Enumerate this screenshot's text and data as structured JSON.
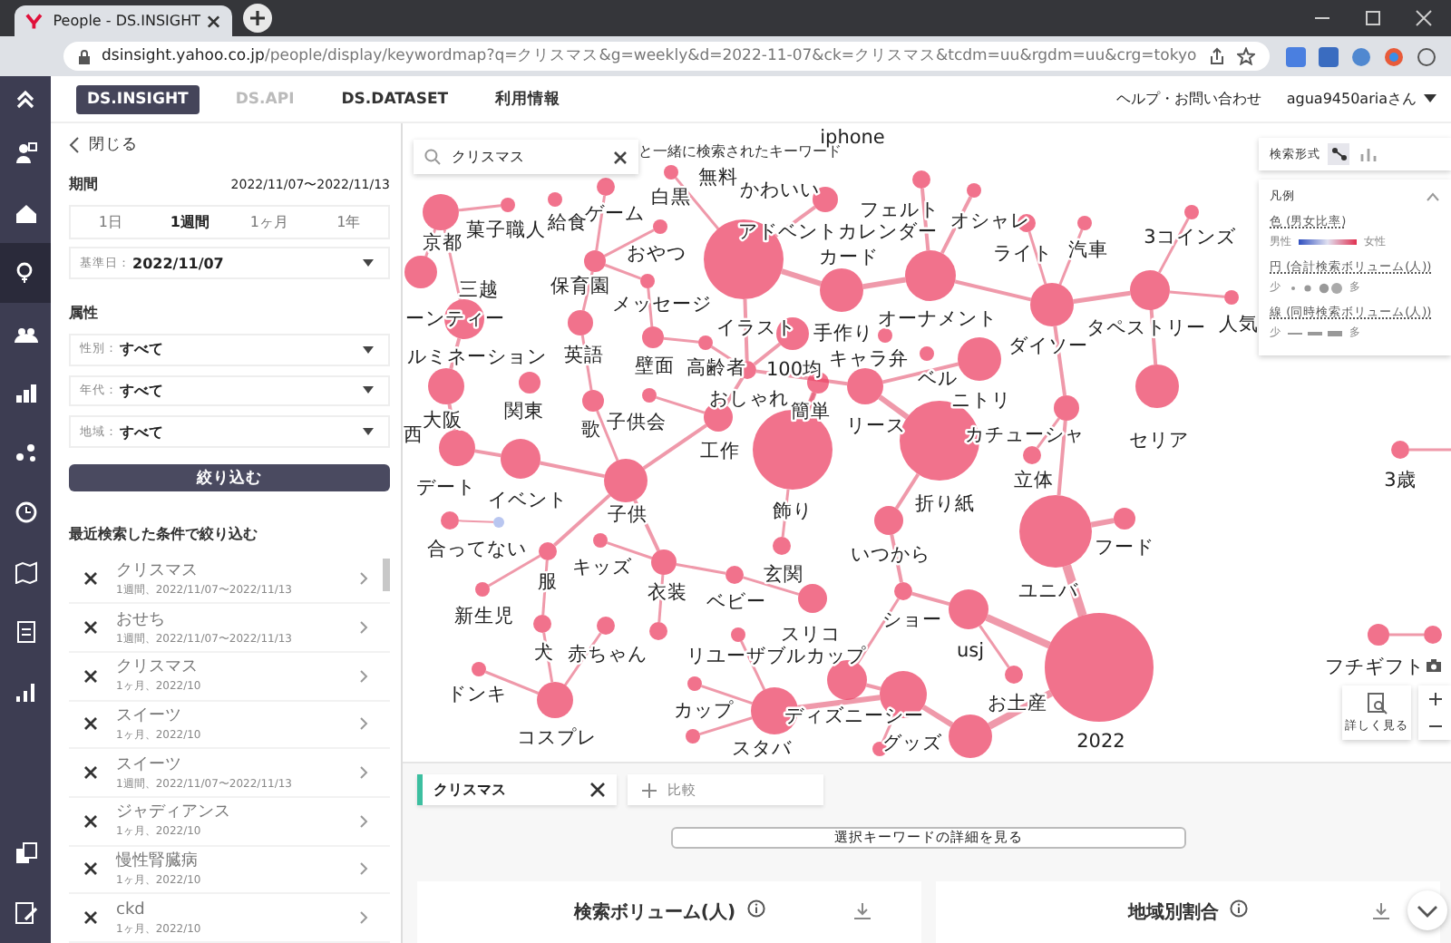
{
  "browser": {
    "tab_title": "People - DS.INSIGHT",
    "url_host": "dsinsight.yahoo.co.jp",
    "url_path": "/people/display/keywordmap?q=クリスマス&g=weekly&d=2022-11-07&ck=クリスマス&tcdm=uu&rgdm=uu&crg=tokyo"
  },
  "nav_rail": {
    "top": [
      {
        "selected": false
      },
      {
        "selected": false
      },
      {
        "selected": true
      },
      {
        "selected": false
      },
      {
        "selected": false
      },
      {
        "selected": false
      },
      {
        "selected": false
      },
      {
        "selected": false
      },
      {
        "selected": false
      },
      {
        "selected": false
      }
    ],
    "bottom": [
      {
        "selected": false
      },
      {
        "selected": false
      }
    ]
  },
  "top_nav": {
    "tabs": [
      {
        "label": "DS.INSIGHT",
        "selected": true,
        "disabled": false
      },
      {
        "label": "DS.API",
        "selected": false,
        "disabled": true
      },
      {
        "label": "DS.DATASET",
        "selected": false,
        "disabled": false
      },
      {
        "label": "利用情報",
        "selected": false,
        "disabled": false
      }
    ],
    "help": "ヘルプ・お問い合わせ",
    "user": "agua9450ariaさん"
  },
  "filter_panel": {
    "close": "閉じる",
    "period_title": "期間",
    "period_range": "2022/11/07〜2022/11/13",
    "periods": [
      {
        "label": "1日",
        "selected": false
      },
      {
        "label": "1週間",
        "selected": true
      },
      {
        "label": "1ヶ月",
        "selected": false
      },
      {
        "label": "1年",
        "selected": false
      }
    ],
    "base_date": {
      "label": "基準日：",
      "value": "2022/11/07"
    },
    "attribute_title": "属性",
    "attributes": [
      {
        "label": "性別：",
        "value": "すべて"
      },
      {
        "label": "年代：",
        "value": "すべて"
      },
      {
        "label": "地域：",
        "value": "すべて"
      }
    ],
    "apply_button": "絞り込む",
    "recent_title": "最近検索した条件で絞り込む",
    "recent": [
      {
        "keyword": "クリスマス",
        "detail": "1週間、2022/11/07〜2022/11/13"
      },
      {
        "keyword": "おせち",
        "detail": "1週間、2022/11/07〜2022/11/13"
      },
      {
        "keyword": "クリスマス",
        "detail": "1ヶ月、2022/10"
      },
      {
        "keyword": "スイーツ",
        "detail": "1ヶ月、2022/10"
      },
      {
        "keyword": "スイーツ",
        "detail": "1週間、2022/11/07〜2022/11/13"
      },
      {
        "keyword": "ジャディアンス",
        "detail": "1ヶ月、2022/10"
      },
      {
        "keyword": "慢性腎臓病",
        "detail": "1ヶ月、2022/10"
      },
      {
        "keyword": "ckd",
        "detail": "1ヶ月、2022/10"
      }
    ]
  },
  "keyword_map": {
    "search": {
      "value": "クリスマス"
    },
    "caption": "と一緒に検索されたキーワード",
    "nodes": [
      {
        "label": "iphone"
      },
      {
        "label": "白黒"
      },
      {
        "label": "無料"
      },
      {
        "label": "かわいい"
      },
      {
        "label": "京都"
      },
      {
        "label": "菓子職人"
      },
      {
        "label": "給食"
      },
      {
        "label": "ゲーム"
      },
      {
        "label": "おやつ"
      },
      {
        "label": "アドベントカレンダー"
      },
      {
        "label": "カード"
      },
      {
        "label": "フェルト"
      },
      {
        "label": "オシャレ"
      },
      {
        "label": "ライト"
      },
      {
        "label": "汽車"
      },
      {
        "label": "3コインズ"
      },
      {
        "label": "三越"
      },
      {
        "label": "ーンティー"
      },
      {
        "label": "保育園"
      },
      {
        "label": "メッセージ"
      },
      {
        "label": "イラスト"
      },
      {
        "label": "手作り"
      },
      {
        "label": "オーナメント"
      },
      {
        "label": "タペストリー"
      },
      {
        "label": "人気"
      },
      {
        "label": "ダイソー"
      },
      {
        "label": "ルミネーション"
      },
      {
        "label": "英語"
      },
      {
        "label": "壁面"
      },
      {
        "label": "高齢者"
      },
      {
        "label": "100均"
      },
      {
        "label": "キャラ弁"
      },
      {
        "label": "ベル"
      },
      {
        "label": "おしゃれ"
      },
      {
        "label": "ニトリ"
      },
      {
        "label": "西"
      },
      {
        "label": "大阪"
      },
      {
        "label": "関東"
      },
      {
        "label": "歌"
      },
      {
        "label": "子供会"
      },
      {
        "label": "工作"
      },
      {
        "label": "簡単"
      },
      {
        "label": "リース"
      },
      {
        "label": "カチューシャ"
      },
      {
        "label": "セリア"
      },
      {
        "label": "立体"
      },
      {
        "label": "飾り"
      },
      {
        "label": "折り紙"
      },
      {
        "label": "デート"
      },
      {
        "label": "イベント"
      },
      {
        "label": "子供"
      },
      {
        "label": "合ってない"
      },
      {
        "label": "いつから"
      },
      {
        "label": "フード"
      },
      {
        "label": "ユニバ"
      },
      {
        "label": "3歳"
      },
      {
        "label": "服"
      },
      {
        "label": "キッズ"
      },
      {
        "label": "衣装"
      },
      {
        "label": "玄関"
      },
      {
        "label": "ベビー"
      },
      {
        "label": "スリコ"
      },
      {
        "label": "新生児"
      },
      {
        "label": "ショー"
      },
      {
        "label": "犬"
      },
      {
        "label": "赤ちゃん"
      },
      {
        "label": "リユーザブルカップ"
      },
      {
        "label": "usj"
      },
      {
        "label": "お土産"
      },
      {
        "label": "2022"
      },
      {
        "label": "ドンキ"
      },
      {
        "label": "コスプレ"
      },
      {
        "label": "カップ"
      },
      {
        "label": "ディズニーシー"
      },
      {
        "label": "スタバ"
      },
      {
        "label": "グッズ"
      },
      {
        "label": "フチギフト"
      }
    ],
    "search_format": {
      "label": "検索形式",
      "modes": [
        {
          "selected": true
        },
        {
          "selected": false
        }
      ]
    },
    "legend": {
      "title": "凡例",
      "expanded": true,
      "items": [
        {
          "kind": "gradient",
          "label": "色 (男女比率)",
          "low": "男性",
          "high": "女性"
        },
        {
          "kind": "circles",
          "label": "円 (合計検索ボリューム(人))",
          "low": "少",
          "high": "多"
        },
        {
          "kind": "lines",
          "label": "線 (同時検索ボリューム(人))",
          "low": "少",
          "high": "多"
        }
      ]
    },
    "detail_button": "詳しく見る"
  },
  "bottom": {
    "keyword_tabs": [
      {
        "label": "クリスマス",
        "color": "#3cbfa0"
      }
    ],
    "compare": "比較",
    "detail_button": "選択キーワードの詳細を見る",
    "cards": [
      {
        "title": "検索ボリューム(人)"
      },
      {
        "title": "地域別割合"
      }
    ]
  }
}
